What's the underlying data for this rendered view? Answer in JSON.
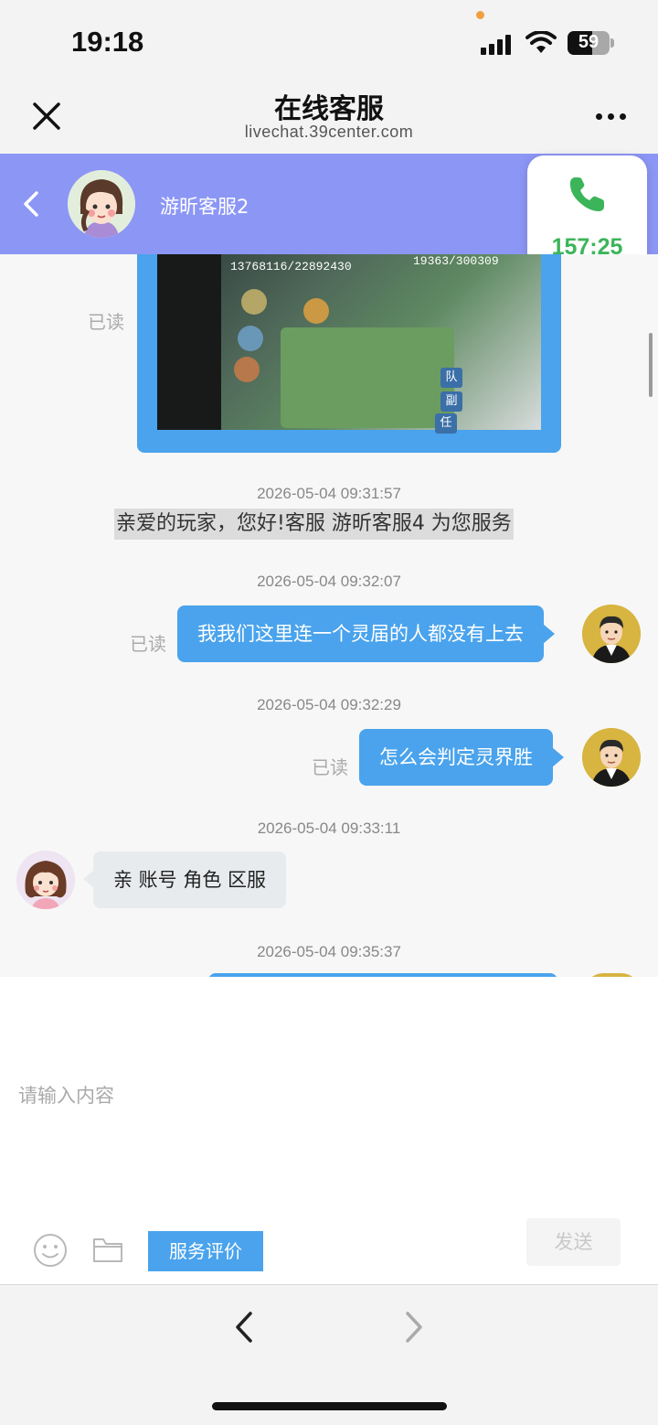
{
  "status_bar": {
    "time": "19:18",
    "battery_level": 59,
    "icons": [
      "signal-icon",
      "wifi-icon",
      "battery-icon"
    ]
  },
  "browser": {
    "title": "在线客服",
    "url": "livechat.39center.com",
    "icons": [
      "close-icon",
      "more-icon"
    ]
  },
  "chat_header": {
    "agent_name": "游昕客服2",
    "icons": [
      "back-chevron-icon",
      "agent-avatar"
    ]
  },
  "call": {
    "duration": "157:25",
    "icon": "phone-icon",
    "color": "#3cb55a"
  },
  "messages": {
    "image_message": {
      "read_status": "已读",
      "image_text": {
        "stat_a": "13768116/22892430",
        "stat_b": "19363/300309",
        "tag_1": "队",
        "tag_2": "副",
        "tag_3": "任"
      }
    },
    "items": [
      {
        "timestamp": "2026-05-04 09:31:57",
        "type": "system",
        "text": "亲爱的玩家，您好!客服 游昕客服4 为您服务"
      },
      {
        "timestamp": "2026-05-04 09:32:07",
        "type": "outgoing",
        "text": "我我们这里连一个灵届的人都没有上去",
        "read_status": "已读"
      },
      {
        "timestamp": "2026-05-04 09:32:29",
        "type": "outgoing",
        "text": "怎么会判定灵界胜",
        "read_status": "已读"
      },
      {
        "timestamp": "2026-05-04 09:33:11",
        "type": "incoming",
        "text": "亲 账号 角色 区服"
      },
      {
        "timestamp": "2026-05-04 09:35:37",
        "type": "outgoing-partial"
      }
    ]
  },
  "input": {
    "placeholder": "请输入内容",
    "value": "",
    "rate_label": "服务评价",
    "send_label": "发送",
    "icons": [
      "emoji-icon",
      "folder-icon"
    ]
  },
  "nav": {
    "icons": [
      "nav-back-icon",
      "nav-forward-icon"
    ]
  },
  "colors": {
    "header_bg": "#8c96f5",
    "bubble_blue": "#4aa3ec",
    "incoming_bubble": "#e8ebee"
  }
}
